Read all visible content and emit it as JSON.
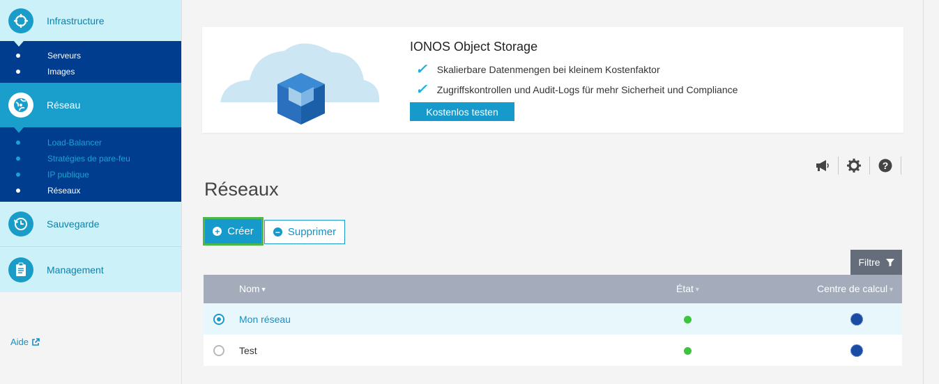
{
  "sidebar": {
    "sections": [
      {
        "label": "Infrastructure",
        "icon": "infrastructure-icon"
      },
      {
        "label": "Réseau",
        "icon": "network-globe-icon"
      },
      {
        "label": "Sauvegarde",
        "icon": "backup-clock-icon"
      },
      {
        "label": "Management",
        "icon": "clipboard-icon"
      }
    ],
    "infrastructure_items": [
      "Serveurs",
      "Images"
    ],
    "reseau_items": [
      "Load-Balancer",
      "Stratégies de pare-feu",
      "IP publique",
      "Réseaux"
    ],
    "help_label": "Aide"
  },
  "banner": {
    "title": "IONOS Object Storage",
    "features": [
      "Skalierbare Datenmengen bei kleinem Kostenfaktor",
      "Zugriffskontrollen und Audit-Logs für mehr Sicherheit und Compliance"
    ],
    "cta_label": "Kostenlos testen"
  },
  "toolbar": {
    "icons": [
      "megaphone-icon",
      "gear-icon",
      "help-icon"
    ]
  },
  "page": {
    "title": "Réseaux"
  },
  "actions": {
    "create_label": "Créer",
    "delete_label": "Supprimer",
    "filter_label": "Filtre"
  },
  "table": {
    "columns": [
      "Nom",
      "État",
      "Centre de calcul"
    ],
    "rows": [
      {
        "name": "Mon réseau",
        "selected": true,
        "state_color": "#3cc43c"
      },
      {
        "name": "Test",
        "selected": false,
        "state_color": "#3cc43c"
      }
    ]
  },
  "colors": {
    "accent": "#1699cb",
    "nav_dark": "#003d8f",
    "highlight": "#4cb84a",
    "status_ok": "#3cc43c"
  }
}
